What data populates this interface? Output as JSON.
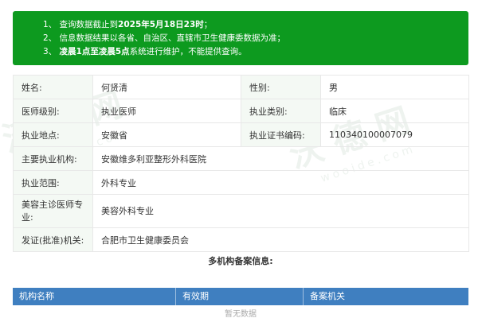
{
  "notice": {
    "line1_prefix": "1、 查询数据截止到",
    "line1_bold": "2025年5月18日23时",
    "line1_suffix": "；",
    "line2": "2、 信息数据结果以各省、自治区、直辖市卫生健康委数据为准；",
    "line3_prefix": "3、 ",
    "line3_bold": "凌晨1点至凌晨5点",
    "line3_suffix": "系统进行维护，不能提供查询。"
  },
  "doctor": {
    "name_label": "姓名:",
    "name": "何贤清",
    "gender_label": "性别:",
    "gender": "男",
    "level_label": "医师级别:",
    "level": "执业医师",
    "category_label": "执业类别:",
    "category": "临床",
    "location_label": "执业地点:",
    "location": "安徽省",
    "cert_label": "执业证书编码:",
    "cert": "110340100007079",
    "institution_label": "主要执业机构:",
    "institution": "安徽维多利亚整形外科医院",
    "scope_label": "执业范围:",
    "scope": "外科专业",
    "specialty_label": "美容主诊医师专业:",
    "specialty": "美容外科专业",
    "issuer_label": "发证(批准)机关:",
    "issuer": "合肥市卫生健康委员会"
  },
  "watermark": {
    "text": "沃 德 网",
    "sub": "wooide.com"
  },
  "multi": {
    "title": "多机构备案信息:",
    "columns": [
      "机构名称",
      "有效期",
      "备案机关"
    ],
    "empty_text": "暂无数据"
  },
  "colors": {
    "notice_bg": "#0d9a1f",
    "header_bg": "#3f7fc0",
    "label_bg": "#f4f9f4"
  }
}
